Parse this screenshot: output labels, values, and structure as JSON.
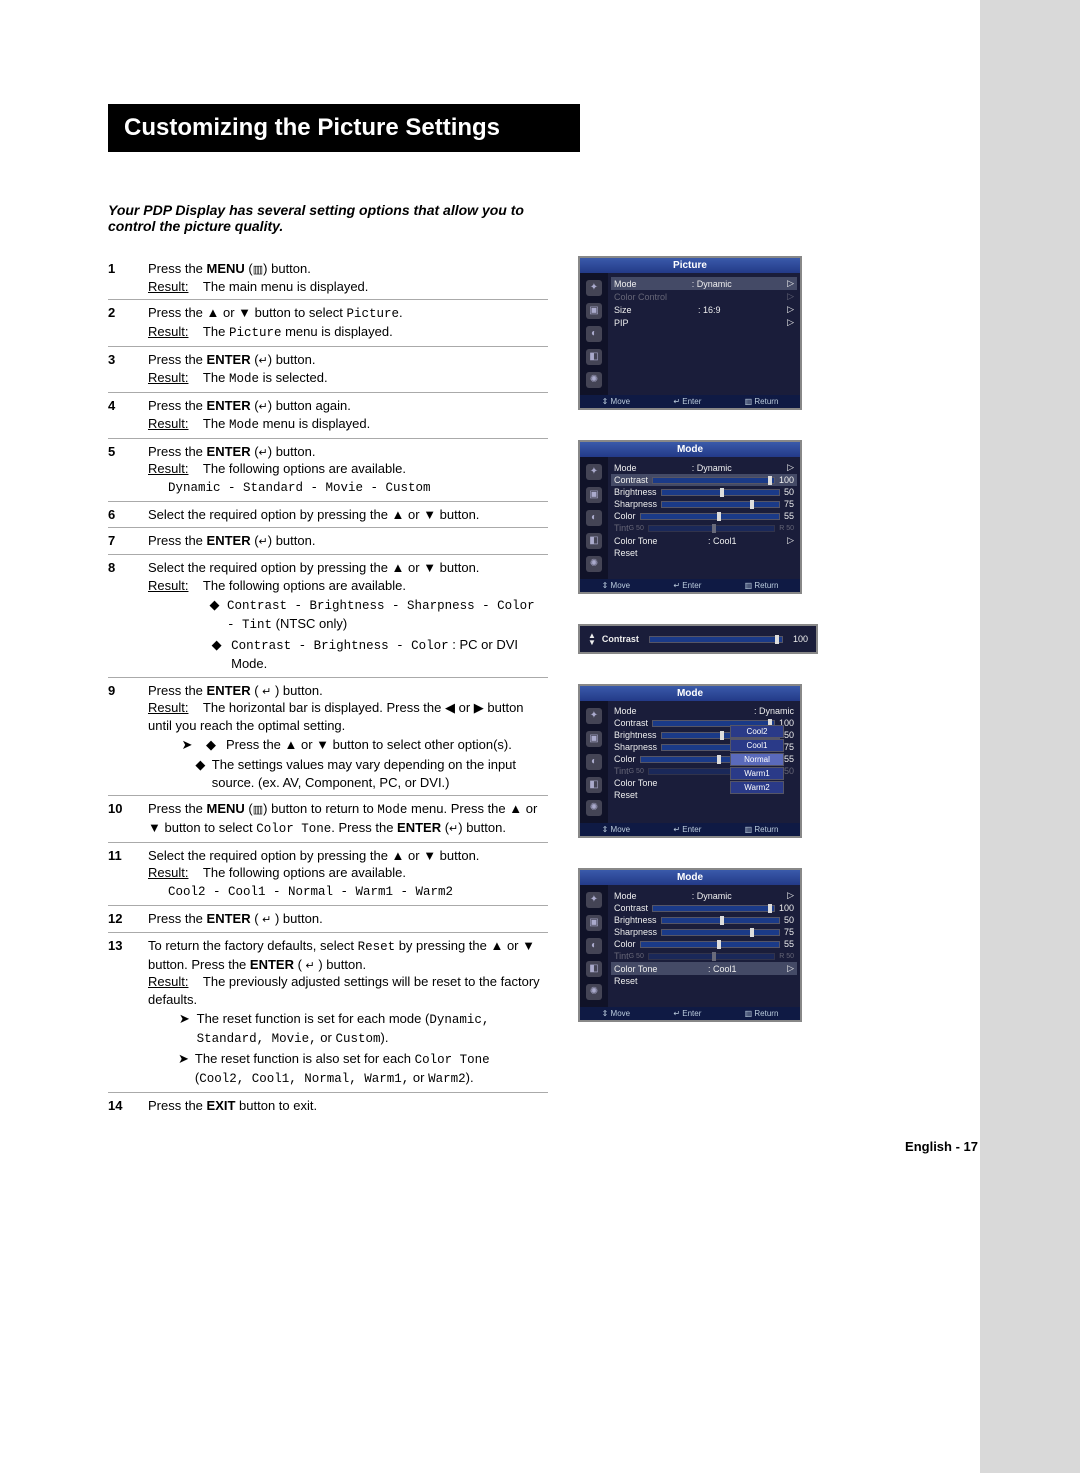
{
  "title": "Customizing the Picture Settings",
  "intro": "Your PDP Display has several setting options that allow you to control the picture quality.",
  "labels": {
    "result": "Result:",
    "menu": "MENU",
    "enter": "ENTER",
    "exit": "EXIT"
  },
  "steps": {
    "s1_a": "Press the ",
    "s1_b": " (",
    "s1_c": ") button.",
    "s1_res": "The main menu is displayed.",
    "s2_a": "Press the ▲ or ▼ button to select ",
    "s2_mono": "Picture",
    "s2_b": ".",
    "s2_res_a": "The ",
    "s2_res_mono": "Picture",
    "s2_res_b": " menu is displayed.",
    "s3_a": "Press the ",
    "s3_b": " (",
    "s3_c": ") button.",
    "s3_res_a": "The ",
    "s3_res_mono": "Mode",
    "s3_res_b": " is selected.",
    "s4_a": "Press the ",
    "s4_b": " (",
    "s4_c": ") button again.",
    "s4_res_a": "The ",
    "s4_res_mono": "Mode",
    "s4_res_b": " menu is displayed.",
    "s5_a": "Press the ",
    "s5_b": " (",
    "s5_c": ") button.",
    "s5_res": "The following options are available.",
    "s5_opts": "Dynamic - Standard - Movie - Custom",
    "s6": "Select the required option by pressing the ▲ or ▼ button.",
    "s7_a": "Press the ",
    "s7_b": " (",
    "s7_c": ") button.",
    "s8_a": "Select the required option by pressing the ▲ or ▼ button.",
    "s8_res": "The following options are available.",
    "s8_bul1_mono": "Contrast - Brightness - Sharpness - Color - Tint",
    "s8_bul1_tail": " (NTSC only)",
    "s8_bul2_mono": "Contrast - Brightness  - Color",
    "s8_bul2_tail": " : PC or DVI Mode.",
    "s9_a": "Press the ",
    "s9_b": " ( ",
    "s9_c": " ) button.",
    "s9_res": "The horizontal bar is displayed. Press the ◀ or ▶ button until you reach the optimal setting.",
    "s9_bul1": "Press the ▲ or ▼ button to select other option(s).",
    "s9_bul2": "The settings values may vary depending on the input source. (ex. AV, Component, PC, or DVI.)",
    "s10_a": "Press the ",
    "s10_b": " (",
    "s10_c": ") button to return to ",
    "s10_mono1": "Mode",
    "s10_d": " menu. Press the ▲ or ▼ button to select ",
    "s10_mono2": "Color Tone",
    "s10_e": ". Press the ",
    "s10_f": " (",
    "s10_g": ") button.",
    "s11_a": "Select the required option by pressing the ▲ or ▼ button.",
    "s11_res": "The following options are available.",
    "s11_opts": "Cool2 - Cool1 - Normal - Warm1 - Warm2",
    "s12_a": "Press the ",
    "s12_b": " ( ",
    "s12_c": " ) button.",
    "s13_a": "To return the factory defaults, select ",
    "s13_mono": "Reset",
    "s13_b": " by pressing the ▲ or ▼ button. Press the ",
    "s13_c": " ( ",
    "s13_d": " ) button.",
    "s13_res": "The previously adjusted settings will be reset to the factory defaults.",
    "s13_bul1_a": "The reset function is set for each mode (",
    "s13_bul1_mono": "Dynamic, Standard, Movie,",
    "s13_bul1_mid": " or ",
    "s13_bul1_mono2": "Custom",
    "s13_bul1_b": ").",
    "s13_bul2_a": "The reset function is also set for each ",
    "s13_bul2_mono": "Color Tone",
    "s13_bul2_b": " (",
    "s13_bul2_mono2": "Cool2, Cool1, Normal, Warm1,",
    "s13_bul2_mid": " or ",
    "s13_bul2_mono3": "Warm2",
    "s13_bul2_c": ").",
    "s14_a": "Press the ",
    "s14_b": " button to exit."
  },
  "osd": {
    "picture": {
      "title": "Picture",
      "rows": [
        {
          "label": "Mode",
          "value": ": Dynamic"
        },
        {
          "label": "Color Control",
          "value": ""
        },
        {
          "label": "Size",
          "value": ": 16:9"
        },
        {
          "label": "PIP",
          "value": ""
        }
      ],
      "hint": [
        "⇕ Move",
        "↵ Enter",
        "▥ Return"
      ]
    },
    "mode": {
      "title": "Mode",
      "rows": [
        {
          "label": "Mode",
          "value": ": Dynamic"
        },
        {
          "label": "Contrast",
          "slider": 100,
          "num": "100"
        },
        {
          "label": "Brightness",
          "slider": 50,
          "num": "50"
        },
        {
          "label": "Sharpness",
          "slider": 75,
          "num": "75"
        },
        {
          "label": "Color",
          "slider": 55,
          "num": "55"
        },
        {
          "label": "Tint",
          "pre": "G 50",
          "slider": 50,
          "num": "R 50",
          "dim": true
        },
        {
          "label": "Color Tone",
          "value": ": Cool1"
        },
        {
          "label": "Reset",
          "value": ""
        }
      ],
      "hint": [
        "⇕ Move",
        "↵ Enter",
        "▥ Return"
      ]
    },
    "contrast_bar": {
      "label": "Contrast",
      "value": "100"
    },
    "colortone": {
      "title": "Mode",
      "rows": [
        {
          "label": "Mode",
          "value": ": Dynamic"
        },
        {
          "label": "Contrast",
          "num": "100"
        },
        {
          "label": "Brightness",
          "num": "50"
        },
        {
          "label": "Sharpness",
          "num": "75"
        },
        {
          "label": "Color",
          "num": "55"
        },
        {
          "label": "Tint",
          "pre": "G 50",
          "num": "50",
          "dim": true
        },
        {
          "label": "Color Tone"
        },
        {
          "label": "Reset"
        }
      ],
      "tones": [
        "Cool2",
        "Cool1",
        "Normal",
        "Warm1",
        "Warm2"
      ],
      "hint": [
        "⇕ Move",
        "↵ Enter",
        "▥ Return"
      ]
    }
  },
  "footer": "English - 17",
  "nums": [
    "1",
    "2",
    "3",
    "4",
    "5",
    "6",
    "7",
    "8",
    "9",
    "10",
    "11",
    "12",
    "13",
    "14"
  ],
  "sym": {
    "diamond": "◆",
    "hand": "➤",
    "menu_icon": "▥",
    "enter_icon": "↵"
  }
}
